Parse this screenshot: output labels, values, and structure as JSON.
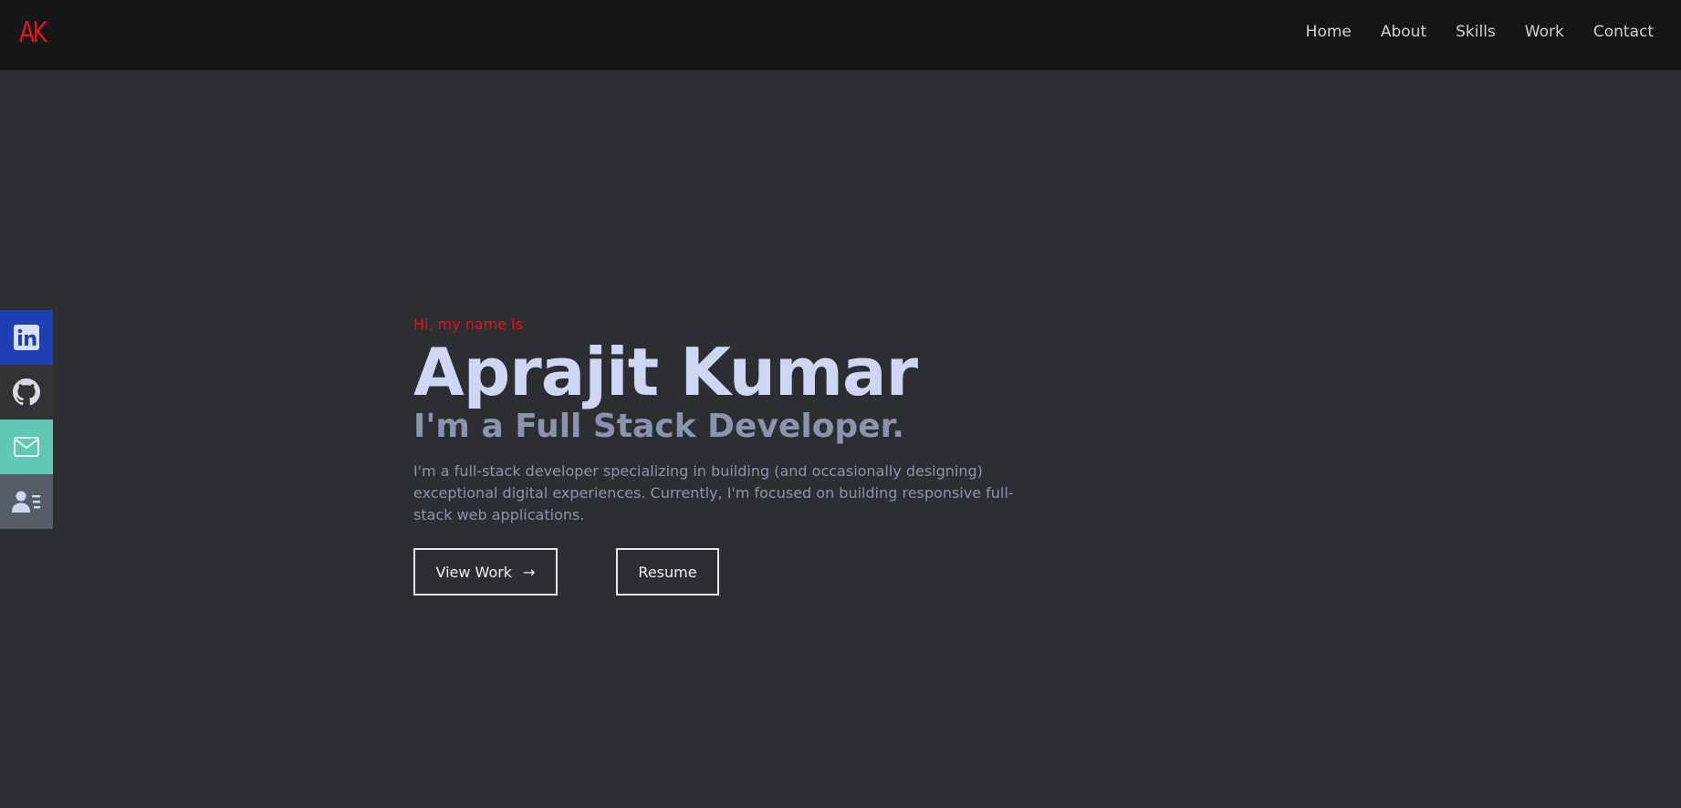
{
  "header": {
    "logo_text": "AK",
    "logo_color": "#e1151f",
    "nav": [
      {
        "label": "Home"
      },
      {
        "label": "About"
      },
      {
        "label": "Skills"
      },
      {
        "label": "Work"
      },
      {
        "label": "Contact"
      }
    ]
  },
  "social": [
    {
      "icon": "linkedin-icon",
      "color": "#1f3fb4"
    },
    {
      "icon": "github-icon",
      "color": "#333333"
    },
    {
      "icon": "mail-icon",
      "color": "#5fc9b6"
    },
    {
      "icon": "contact-card-icon",
      "color": "#565d66"
    }
  ],
  "hero": {
    "greeting": "Hi, my name is",
    "name": "Aprajit Kumar",
    "role": "I'm a Full Stack Developer.",
    "description": "I'm a full-stack developer specializing in building (and occasionally designing) exceptional digital experiences. Currently, I'm focused on building responsive full-stack web applications.",
    "view_work_label": "View Work",
    "arrow": "→",
    "resume_label": "Resume"
  },
  "colors": {
    "background": "#2d2e31",
    "navbar": "#171617",
    "accent": "#e1151f",
    "name_text": "#cdd6f3",
    "muted_text": "#8a94af"
  }
}
